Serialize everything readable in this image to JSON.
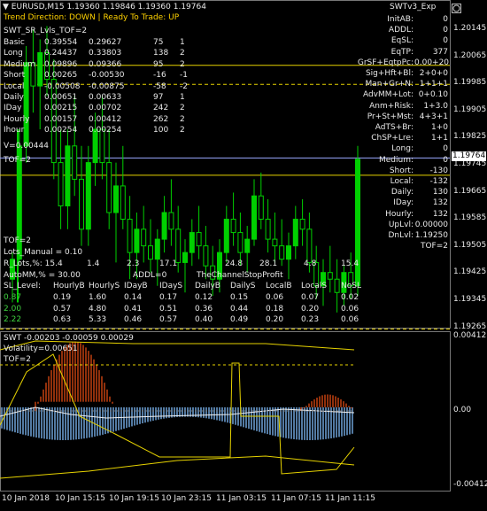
{
  "header": {
    "symbol_line": "EURUSD,M15  1.19360 1.19846 1.19360 1.19764",
    "trend_line": "Trend Direction:  DOWN   |   Ready To Trade:  UP",
    "indicator_title": "SWT_SR_Lvls_TOF=2",
    "expert_name": "SWTv3_Exp"
  },
  "left_table": {
    "rows": [
      {
        "label": "Basic",
        "v1": "0.39554",
        "v2": "0.29627",
        "v3": "75",
        "v4": "1"
      },
      {
        "label": "Long",
        "v1": "0.24437",
        "v2": "0.33803",
        "v3": "138",
        "v4": "2"
      },
      {
        "label": "Medium",
        "v1": "0.09896",
        "v2": "0.09366",
        "v3": "95",
        "v4": "2"
      },
      {
        "label": "Short",
        "v1": "0.00265",
        "v2": "-0.00530",
        "v3": "-16",
        "v4": "-1"
      },
      {
        "label": "Local",
        "v1": "-0.00508",
        "v2": "-0.00875",
        "v3": "-58",
        "v4": "-2"
      },
      {
        "label": "Daily",
        "v1": "0.00651",
        "v2": "0.00633",
        "v3": "97",
        "v4": "1"
      },
      {
        "label": "IDay",
        "v1": "0.00215",
        "v2": "0.00702",
        "v3": "242",
        "v4": "2"
      },
      {
        "label": "Hourly",
        "v1": "0.00157",
        "v2": "0.00412",
        "v3": "262",
        "v4": "2"
      },
      {
        "label": "Ihour",
        "v1": "0.00254",
        "v2": "0.00254",
        "v3": "100",
        "v4": "2"
      }
    ],
    "v_line": "V=0.00444",
    "tof_upper": "TOF=2",
    "tof_lower": "TOF=2",
    "lots_manual": "Lots_Manual = 0.10",
    "lots_pct_label": "R_Lots,%: 15.4",
    "lots_pct_values": [
      "1.4",
      "2.3",
      "17.1",
      "24.8",
      "28.1",
      "4.8",
      "15.4"
    ],
    "autoMM": "AutoMM,% = 30.00",
    "addl": "ADDL=0",
    "channel_stop": "TheChannelStopProfit",
    "sl_headers": [
      "SL_Level:",
      "HourlyB",
      "HourlyS",
      "IDayB",
      "IDayS",
      "DailyB",
      "DailyS",
      "LocalB",
      "LocalS",
      "NoSL"
    ],
    "sl_rows": [
      {
        "cells": [
          "0.87",
          "0.19",
          "1.60",
          "0.14",
          "0.17",
          "0.12",
          "0.15",
          "0.06",
          "0.07",
          "0.02"
        ],
        "color": "#3fd23f"
      },
      {
        "cells": [
          "2.00",
          "0.57",
          "4.80",
          "0.41",
          "0.51",
          "0.36",
          "0.44",
          "0.18",
          "0.20",
          "0.06"
        ],
        "color": "#3fd23f"
      },
      {
        "cells": [
          "2.22",
          "0.63",
          "5.33",
          "0.46",
          "0.57",
          "0.40",
          "0.49",
          "0.20",
          "0.23",
          "0.06"
        ],
        "color": "#3fd23f"
      }
    ]
  },
  "right_panel": {
    "rows": [
      {
        "label": "InitAB:",
        "value": "0"
      },
      {
        "label": "ADDL:",
        "value": "0"
      },
      {
        "label": "EqSL:",
        "value": "0"
      },
      {
        "label": "EqTP:",
        "value": "377"
      },
      {
        "label": "GrSF+EqtpPc:",
        "value": "0.00+20"
      },
      {
        "label": "Sig+Hft+Bl:",
        "value": "2+0+0"
      },
      {
        "label": "Man+Gr+N:",
        "value": "1+1+1"
      },
      {
        "label": "AdvMM+Lot:",
        "value": "0+0.10"
      },
      {
        "label": "Anm+Risk:",
        "value": "1+3.0"
      },
      {
        "label": "Pr+St+Mst:",
        "value": "4+3+1"
      },
      {
        "label": "AdTS+Br:",
        "value": "1+0"
      },
      {
        "label": "ChSP+Lre:",
        "value": "1+1"
      },
      {
        "label": "Long:",
        "value": "0"
      },
      {
        "label": "Medium:",
        "value": "0"
      },
      {
        "label": "Short:",
        "value": "-130"
      },
      {
        "label": "Local:",
        "value": "-132"
      },
      {
        "label": "Daily:",
        "value": "130"
      },
      {
        "label": "IDay:",
        "value": "132"
      },
      {
        "label": "Hourly:",
        "value": "132"
      },
      {
        "label": "UpLvl:",
        "value": "0.00000"
      },
      {
        "label": "DnLvl:",
        "value": "1.19250"
      },
      {
        "label": "",
        "value": "TOF=2"
      }
    ]
  },
  "price_axis": {
    "labels": [
      "1.20145",
      "1.20065",
      "1.19985",
      "1.19905",
      "1.19825",
      "1.19745",
      "1.19665",
      "1.19585",
      "1.19505",
      "1.19425",
      "1.19345",
      "1.19265"
    ],
    "current_price": "1.19764"
  },
  "sub_window": {
    "title_line": "SWT -0.00203 -0.00059 0.00029",
    "volatility": "Volatility=0.00651",
    "tof": "TOF=2",
    "axis_labels": [
      "0.00412",
      "0.00",
      "-0.00412"
    ]
  },
  "time_axis": {
    "labels": [
      "10 Jan 2018",
      "10 Jan 15:15",
      "10 Jan 19:15",
      "10 Jan 23:15",
      "11 Jan 03:15",
      "11 Jan 07:15",
      "11 Jan 11:15"
    ]
  },
  "colors": {
    "candle": "#00d000",
    "level_line": "#e6d200",
    "current_price_line": "#9aa8ff",
    "text_yellow": "#ffd200",
    "hist_blue": "#6fa2d8",
    "hist_red": "#c04010"
  },
  "window_buttons": {
    "minimize_label": "–",
    "maximize_label": "□",
    "close_label": "×"
  },
  "chart_data": {
    "type": "candlestick",
    "candles": [
      [
        1.194,
        1.1948,
        1.1933,
        1.1946
      ],
      [
        1.1946,
        1.1985,
        1.1944,
        1.198
      ],
      [
        1.198,
        1.201,
        1.1975,
        1.2005
      ],
      [
        1.2005,
        1.2015,
        1.199,
        1.1998
      ],
      [
        1.1998,
        1.2012,
        1.1985,
        1.2008
      ],
      [
        1.2008,
        1.2016,
        1.1995,
        1.2
      ],
      [
        1.2,
        1.2006,
        1.197,
        1.1975
      ],
      [
        1.1975,
        1.1985,
        1.1955,
        1.1962
      ],
      [
        1.1962,
        1.1985,
        1.1955,
        1.198
      ],
      [
        1.198,
        1.1995,
        1.1965,
        1.197
      ],
      [
        1.197,
        1.198,
        1.195,
        1.1955
      ],
      [
        1.1955,
        1.198,
        1.195,
        1.1975
      ],
      [
        1.1975,
        1.199,
        1.1968,
        1.1985
      ],
      [
        1.1985,
        1.1995,
        1.197,
        1.1975
      ],
      [
        1.1975,
        1.1985,
        1.1955,
        1.196
      ],
      [
        1.196,
        1.1975,
        1.1945,
        1.1968
      ],
      [
        1.1968,
        1.198,
        1.1955,
        1.1958
      ],
      [
        1.1958,
        1.1965,
        1.194,
        1.1948
      ],
      [
        1.1948,
        1.196,
        1.194,
        1.1955
      ],
      [
        1.1955,
        1.1962,
        1.1945,
        1.195
      ],
      [
        1.195,
        1.1958,
        1.1942,
        1.1946
      ],
      [
        1.1946,
        1.1955,
        1.1938,
        1.1952
      ],
      [
        1.1952,
        1.1965,
        1.1948,
        1.196
      ],
      [
        1.196,
        1.197,
        1.195,
        1.1955
      ],
      [
        1.1955,
        1.1962,
        1.1942,
        1.1945
      ],
      [
        1.1945,
        1.1952,
        1.1936,
        1.1948
      ],
      [
        1.1948,
        1.1958,
        1.1944,
        1.1954
      ],
      [
        1.1954,
        1.1962,
        1.1946,
        1.195
      ],
      [
        1.195,
        1.1956,
        1.194,
        1.1944
      ],
      [
        1.1944,
        1.195,
        1.1935,
        1.194
      ],
      [
        1.194,
        1.1952,
        1.1936,
        1.1948
      ],
      [
        1.1948,
        1.1962,
        1.1945,
        1.1958
      ],
      [
        1.1958,
        1.1966,
        1.195,
        1.1954
      ],
      [
        1.1954,
        1.196,
        1.1944,
        1.1948
      ],
      [
        1.1948,
        1.1956,
        1.1942,
        1.1952
      ],
      [
        1.1952,
        1.197,
        1.195,
        1.1965
      ],
      [
        1.1965,
        1.1972,
        1.1955,
        1.1958
      ],
      [
        1.1958,
        1.1964,
        1.1948,
        1.1952
      ],
      [
        1.1952,
        1.196,
        1.1945,
        1.195
      ],
      [
        1.195,
        1.1958,
        1.1944,
        1.1946
      ],
      [
        1.1946,
        1.1954,
        1.194,
        1.195
      ],
      [
        1.195,
        1.1962,
        1.1946,
        1.1958
      ],
      [
        1.1958,
        1.1964,
        1.195,
        1.1955
      ],
      [
        1.1955,
        1.196,
        1.1942,
        1.1945
      ],
      [
        1.1945,
        1.195,
        1.1934,
        1.1938
      ],
      [
        1.1938,
        1.1946,
        1.1932,
        1.1942
      ],
      [
        1.1942,
        1.195,
        1.1936,
        1.194
      ],
      [
        1.194,
        1.1946,
        1.193,
        1.1936
      ],
      [
        1.1936,
        1.1944,
        1.1932,
        1.1942
      ],
      [
        1.1942,
        1.1948,
        1.1934,
        1.1938
      ],
      [
        1.1938,
        1.198,
        1.1935,
        1.1976
      ]
    ],
    "levels": [
      1.20042,
      1.19985,
      1.19712,
      1.1925
    ]
  }
}
